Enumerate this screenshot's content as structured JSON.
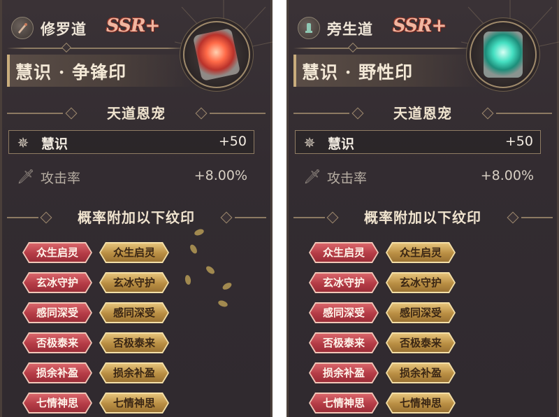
{
  "panels": [
    {
      "path_name": "修罗道",
      "rarity": "SSR+",
      "item_title": "慧识 · 争锋印",
      "emblem_icon": "fire-beast-seal-icon",
      "path_icon": "asura-path-icon",
      "section_blessing": "天道恩宠",
      "main_stat": {
        "name": "慧识",
        "value": "+50"
      },
      "sub_stat": {
        "name": "攻击率",
        "value": "+8.00%"
      },
      "section_marks": "概率附加以下纹印",
      "marks": [
        [
          "众生启灵",
          "众生启灵"
        ],
        [
          "玄冰守护",
          "玄冰守护"
        ],
        [
          "感同深受",
          "感同深受"
        ],
        [
          "否极泰来",
          "否极泰来"
        ],
        [
          "损余补盈",
          "损余补盈"
        ],
        [
          "七情神思",
          "七情神思"
        ]
      ]
    },
    {
      "path_name": "旁生道",
      "rarity": "SSR+",
      "item_title": "慧识 · 野性印",
      "emblem_icon": "jade-beast-seal-icon",
      "path_icon": "animal-path-icon",
      "section_blessing": "天道恩宠",
      "main_stat": {
        "name": "慧识",
        "value": "+50"
      },
      "sub_stat": {
        "name": "攻击率",
        "value": "+8.00%"
      },
      "section_marks": "概率附加以下纹印",
      "marks": [
        [
          "众生启灵",
          "众生启灵"
        ],
        [
          "玄冰守护",
          "玄冰守护"
        ],
        [
          "感同深受",
          "感同深受"
        ],
        [
          "否极泰来",
          "否极泰来"
        ],
        [
          "损余补盈",
          "损余补盈"
        ],
        [
          "七情神思",
          "七情神思"
        ]
      ]
    }
  ],
  "colors": {
    "red_tag": "#b43c46",
    "gold_tag": "#b98e43",
    "panel_bg": "#332c31",
    "text": "#f3e8d6"
  }
}
